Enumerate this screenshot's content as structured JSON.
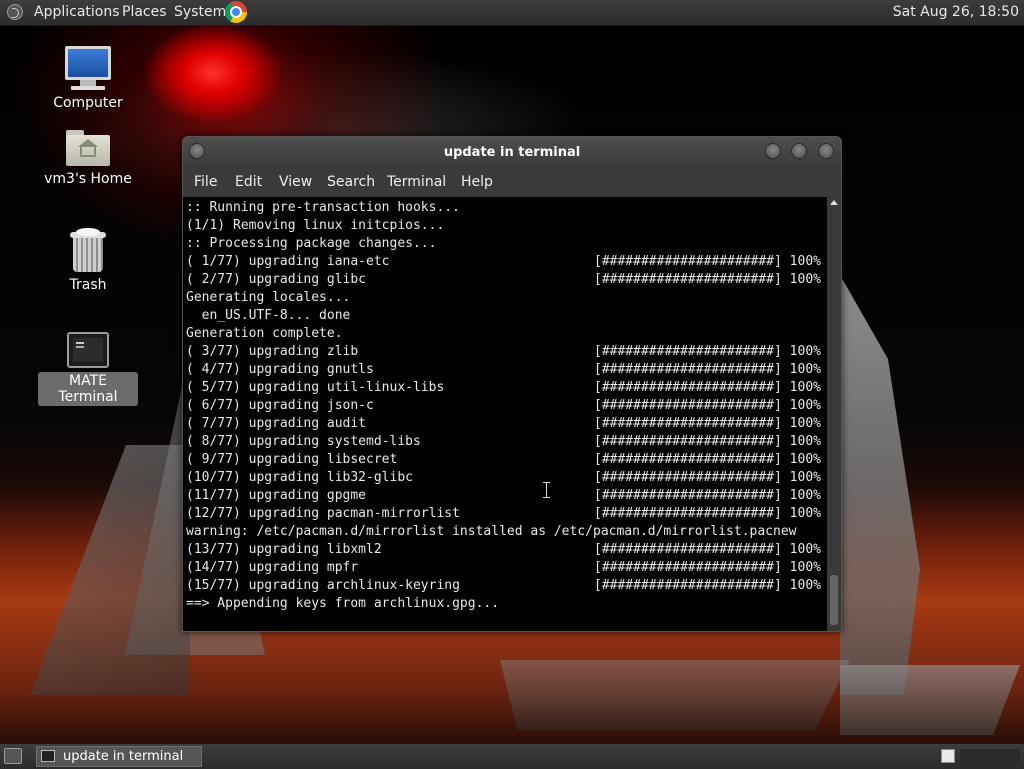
{
  "top_panel": {
    "menus": [
      "Applications",
      "Places",
      "System"
    ],
    "clock": "Sat Aug 26, 18:50"
  },
  "desktop_icons": [
    "Computer",
    "vm3's Home",
    "Trash",
    "MATE Terminal"
  ],
  "window": {
    "title": "update in terminal",
    "menu": [
      "File",
      "Edit",
      "View",
      "Search",
      "Terminal",
      "Help"
    ],
    "lines": [
      {
        "text": ":: Running pre-transaction hooks...",
        "bar": ""
      },
      {
        "text": "(1/1) Removing linux initcpios...",
        "bar": ""
      },
      {
        "text": ":: Processing package changes...",
        "bar": ""
      },
      {
        "text": "( 1/77) upgrading iana-etc",
        "bar": "[######################] 100%"
      },
      {
        "text": "( 2/77) upgrading glibc",
        "bar": "[######################] 100%"
      },
      {
        "text": "Generating locales...",
        "bar": ""
      },
      {
        "text": "  en_US.UTF-8... done",
        "bar": ""
      },
      {
        "text": "Generation complete.",
        "bar": ""
      },
      {
        "text": "( 3/77) upgrading zlib",
        "bar": "[######################] 100%"
      },
      {
        "text": "( 4/77) upgrading gnutls",
        "bar": "[######################] 100%"
      },
      {
        "text": "( 5/77) upgrading util-linux-libs",
        "bar": "[######################] 100%"
      },
      {
        "text": "( 6/77) upgrading json-c",
        "bar": "[######################] 100%"
      },
      {
        "text": "( 7/77) upgrading audit",
        "bar": "[######################] 100%"
      },
      {
        "text": "( 8/77) upgrading systemd-libs",
        "bar": "[######################] 100%"
      },
      {
        "text": "( 9/77) upgrading libsecret",
        "bar": "[######################] 100%"
      },
      {
        "text": "(10/77) upgrading lib32-glibc",
        "bar": "[######################] 100%"
      },
      {
        "text": "(11/77) upgrading gpgme",
        "bar": "[######################] 100%"
      },
      {
        "text": "(12/77) upgrading pacman-mirrorlist",
        "bar": "[######################] 100%"
      },
      {
        "text": "warning: /etc/pacman.d/mirrorlist installed as /etc/pacman.d/mirrorlist.pacnew",
        "bar": ""
      },
      {
        "text": "(13/77) upgrading libxml2",
        "bar": "[######################] 100%"
      },
      {
        "text": "(14/77) upgrading mpfr",
        "bar": "[######################] 100%"
      },
      {
        "text": "(15/77) upgrading archlinux-keyring",
        "bar": "[######################] 100%"
      },
      {
        "text": "==> Appending keys from archlinux.gpg...",
        "bar": ""
      }
    ]
  },
  "taskbar": {
    "task_label": "update in terminal"
  },
  "colors": {
    "terminal_bg": "#000000",
    "terminal_fg": "#e8e8e8",
    "panel_bg": "#333333",
    "selection_bg": "#6b6b6b"
  }
}
